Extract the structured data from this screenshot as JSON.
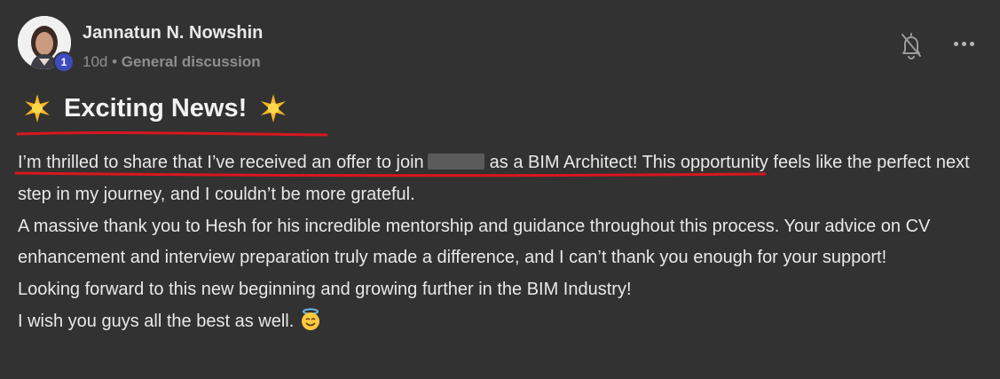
{
  "post": {
    "author": "Jannatun N. Nowshin",
    "avatar_icon": "user-avatar",
    "level_badge": "1",
    "time_ago": "10d",
    "separator": "•",
    "category": "General discussion",
    "actions": {
      "notifications_icon": "bell-off-icon",
      "more_icon": "more-horizontal-icon"
    },
    "headline": {
      "leading_emoji": "glowing-star",
      "text": "Exciting News!",
      "trailing_emoji": "glowing-star"
    },
    "body": {
      "line1_prefix": "I’m thrilled to share that I’ve received an offer to join",
      "line1_suffix": "as a BIM Architect!",
      "line1_rest": " This opportunity feels like the perfect next step in my journey, and I couldn’t be more grateful.",
      "paragraph2": "A massive thank you to Hesh for his incredible mentorship and guidance throughout this process. Your advice on CV enhancement and interview preparation truly made a difference, and I can’t thank you enough for your support!",
      "paragraph3": "Looking forward to this new beginning and growing further in the BIM Industry!",
      "paragraph4": "I wish you guys all the best as well.",
      "closing_emoji": "smiling-face-with-halo"
    },
    "annotation_color": "#d9161f"
  }
}
